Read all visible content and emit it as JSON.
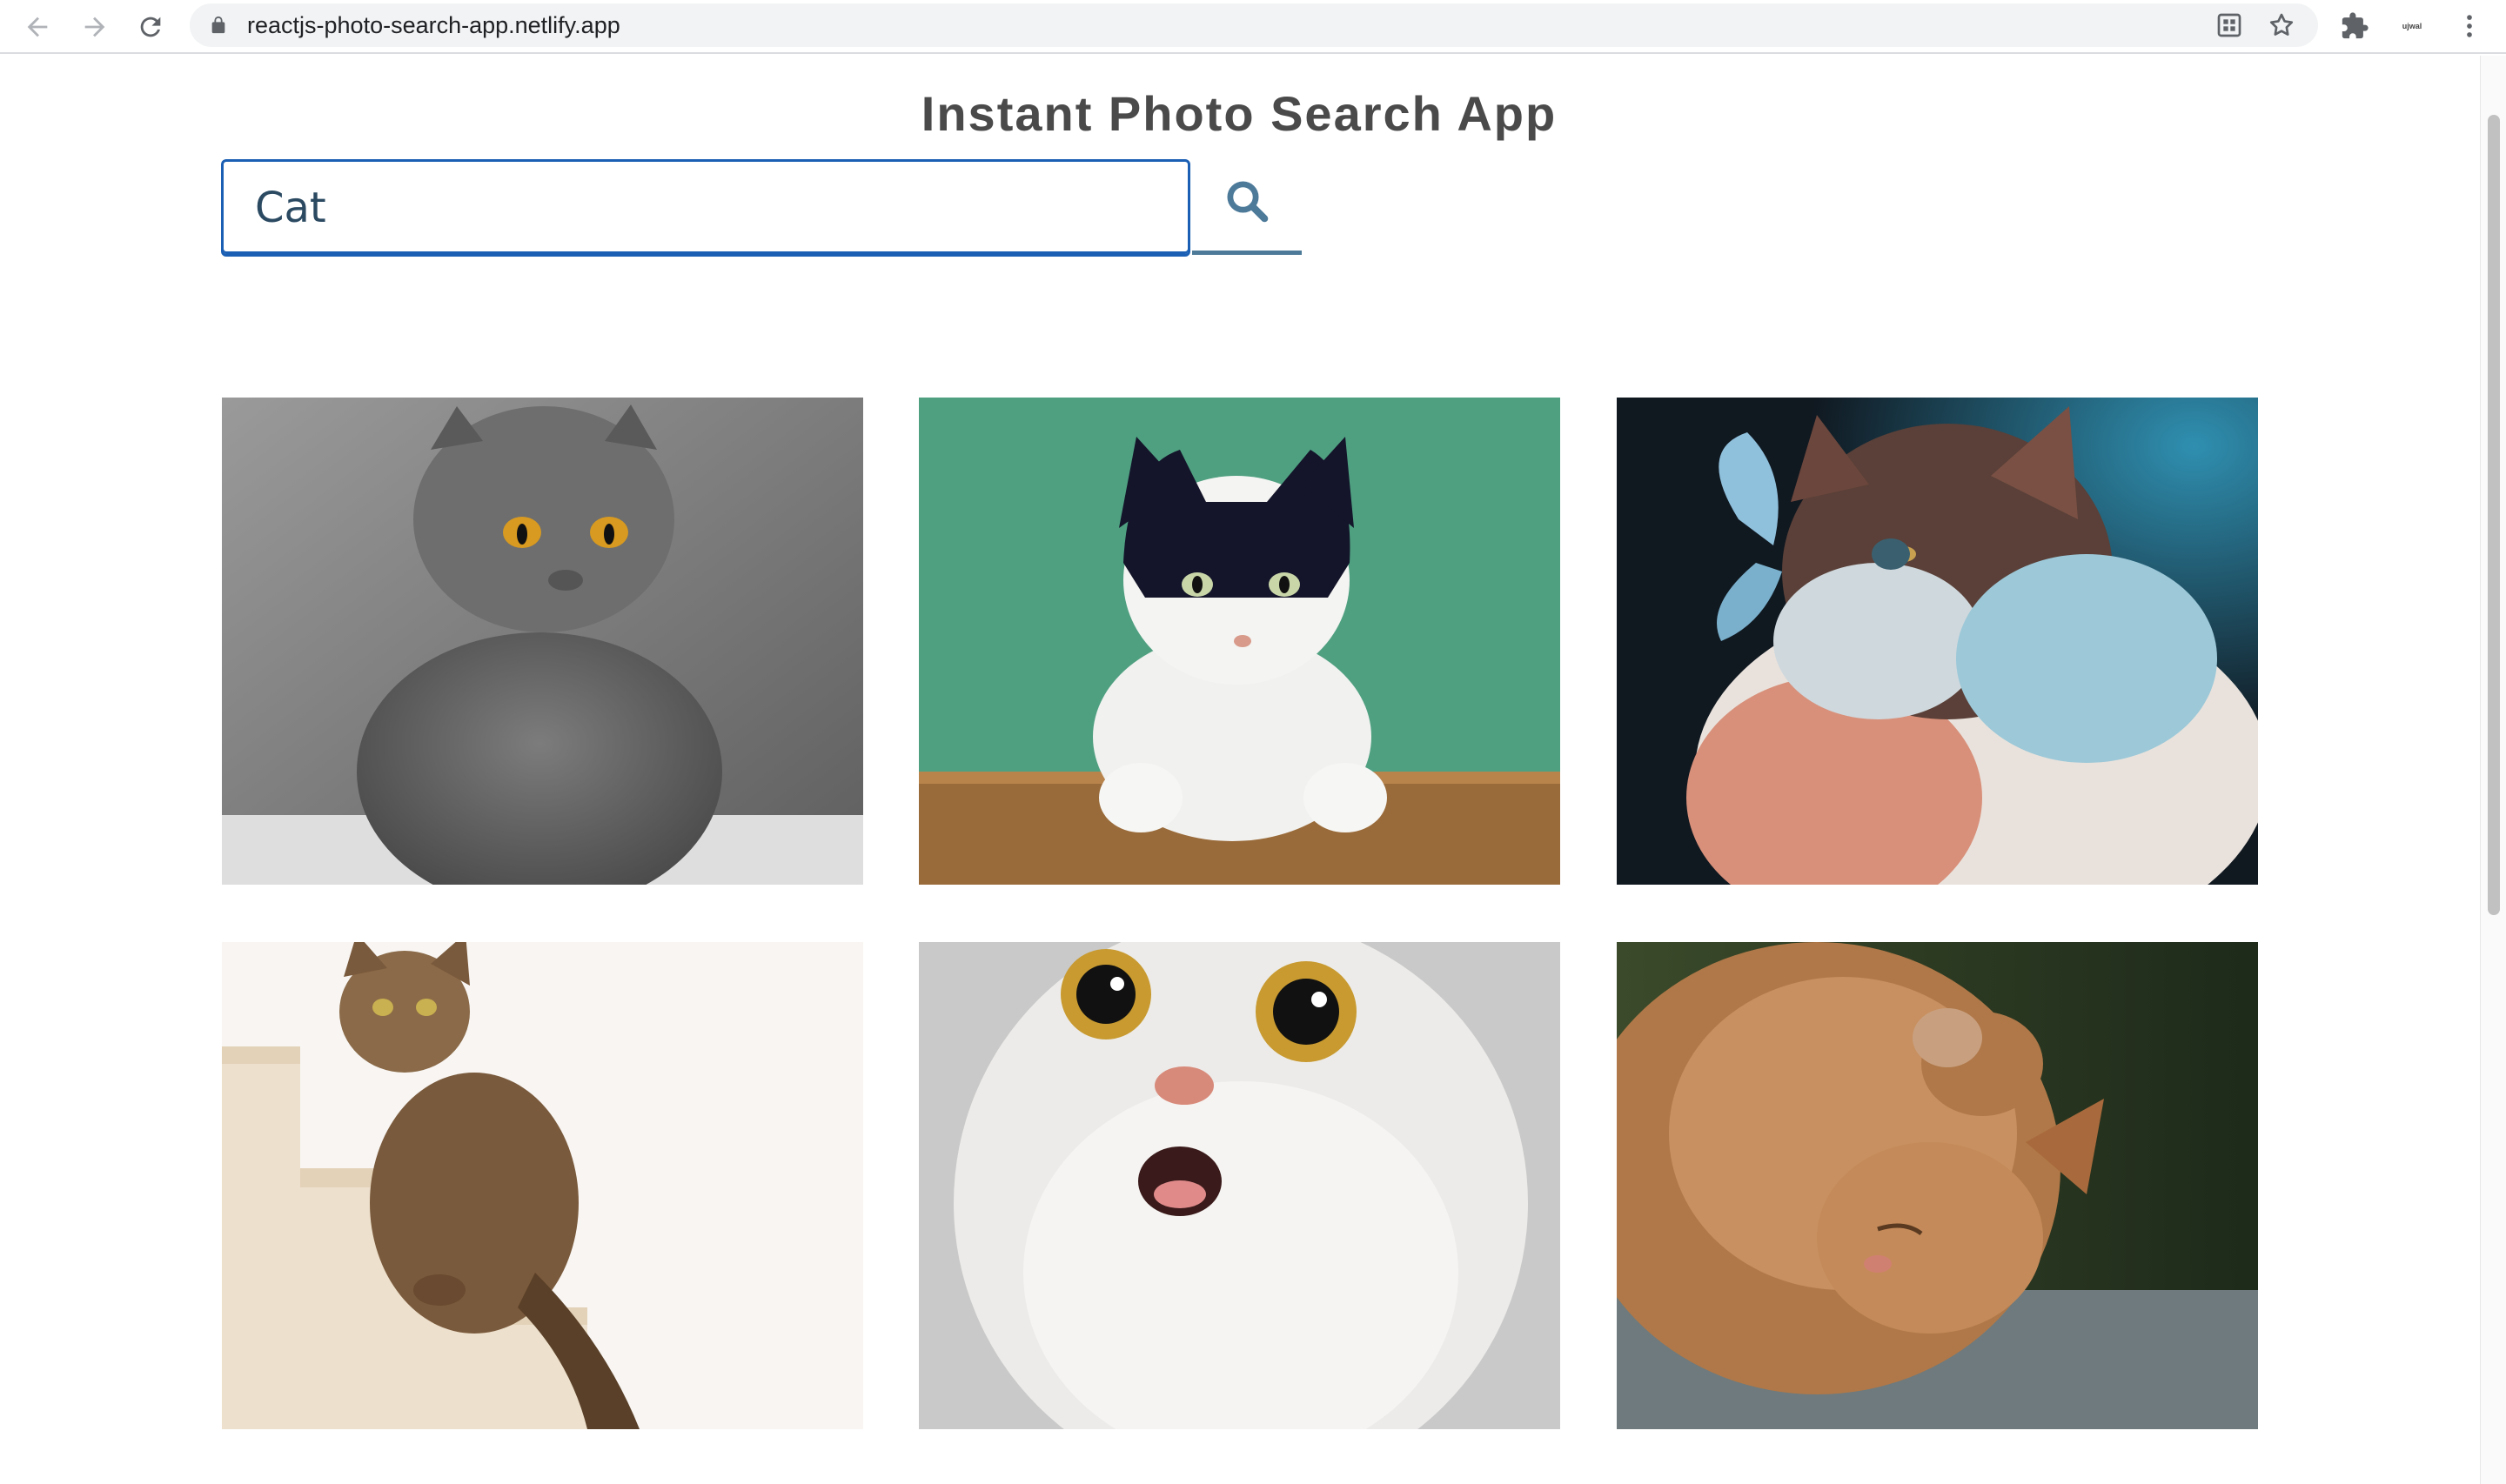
{
  "browser": {
    "url": "reactjs-photo-search-app.netlify.app",
    "profile_label": "ujwal"
  },
  "page": {
    "title": "Instant Photo Search App"
  },
  "search": {
    "value": "Cat",
    "icon": "search-icon"
  },
  "photos": [
    {
      "subject": "gray British shorthair cat sitting",
      "bg": "#8a8a8a"
    },
    {
      "subject": "black and white cat peeking over box",
      "bg": "#4fa081"
    },
    {
      "subject": "fluffy cat with butterfly on nose",
      "bg": "#1b2a30"
    },
    {
      "subject": "tabby cat sitting on stairs",
      "bg": "#f2ede6"
    },
    {
      "subject": "surprised white cat with wide eyes",
      "bg": "#cfcfcf"
    },
    {
      "subject": "orange cat sleeping on its back",
      "bg": "#8a6a4c"
    }
  ],
  "colors": {
    "accent": "#1a5fb4",
    "search_icon": "#4d7a99",
    "title": "#4a4a4a"
  }
}
